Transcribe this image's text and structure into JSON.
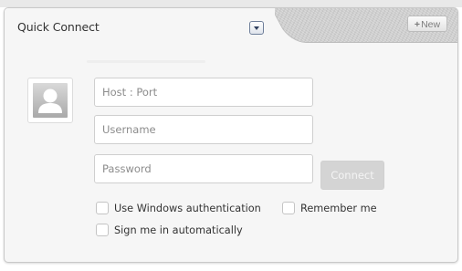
{
  "header": {
    "title": "Quick Connect",
    "new_button": {
      "plus": "+",
      "label": "New"
    }
  },
  "form": {
    "host": {
      "value": "",
      "placeholder": "Host : Port"
    },
    "username": {
      "value": "",
      "placeholder": "Username"
    },
    "password": {
      "value": "",
      "placeholder": "Password"
    },
    "connect_label": "Connect"
  },
  "options": {
    "windows_auth": {
      "label": "Use Windows authentication",
      "checked": false
    },
    "remember_me": {
      "label": "Remember me",
      "checked": false
    },
    "auto_sign_in": {
      "label": "Sign me in automatically",
      "checked": false
    }
  },
  "icons": {
    "dropdown": "chevron-down-icon",
    "avatar": "user-silhouette-icon"
  },
  "colors": {
    "panel_background": "#f6f6f6",
    "connect_disabled": "#d4d4d4",
    "dropdown_border": "#6f7f9a"
  }
}
